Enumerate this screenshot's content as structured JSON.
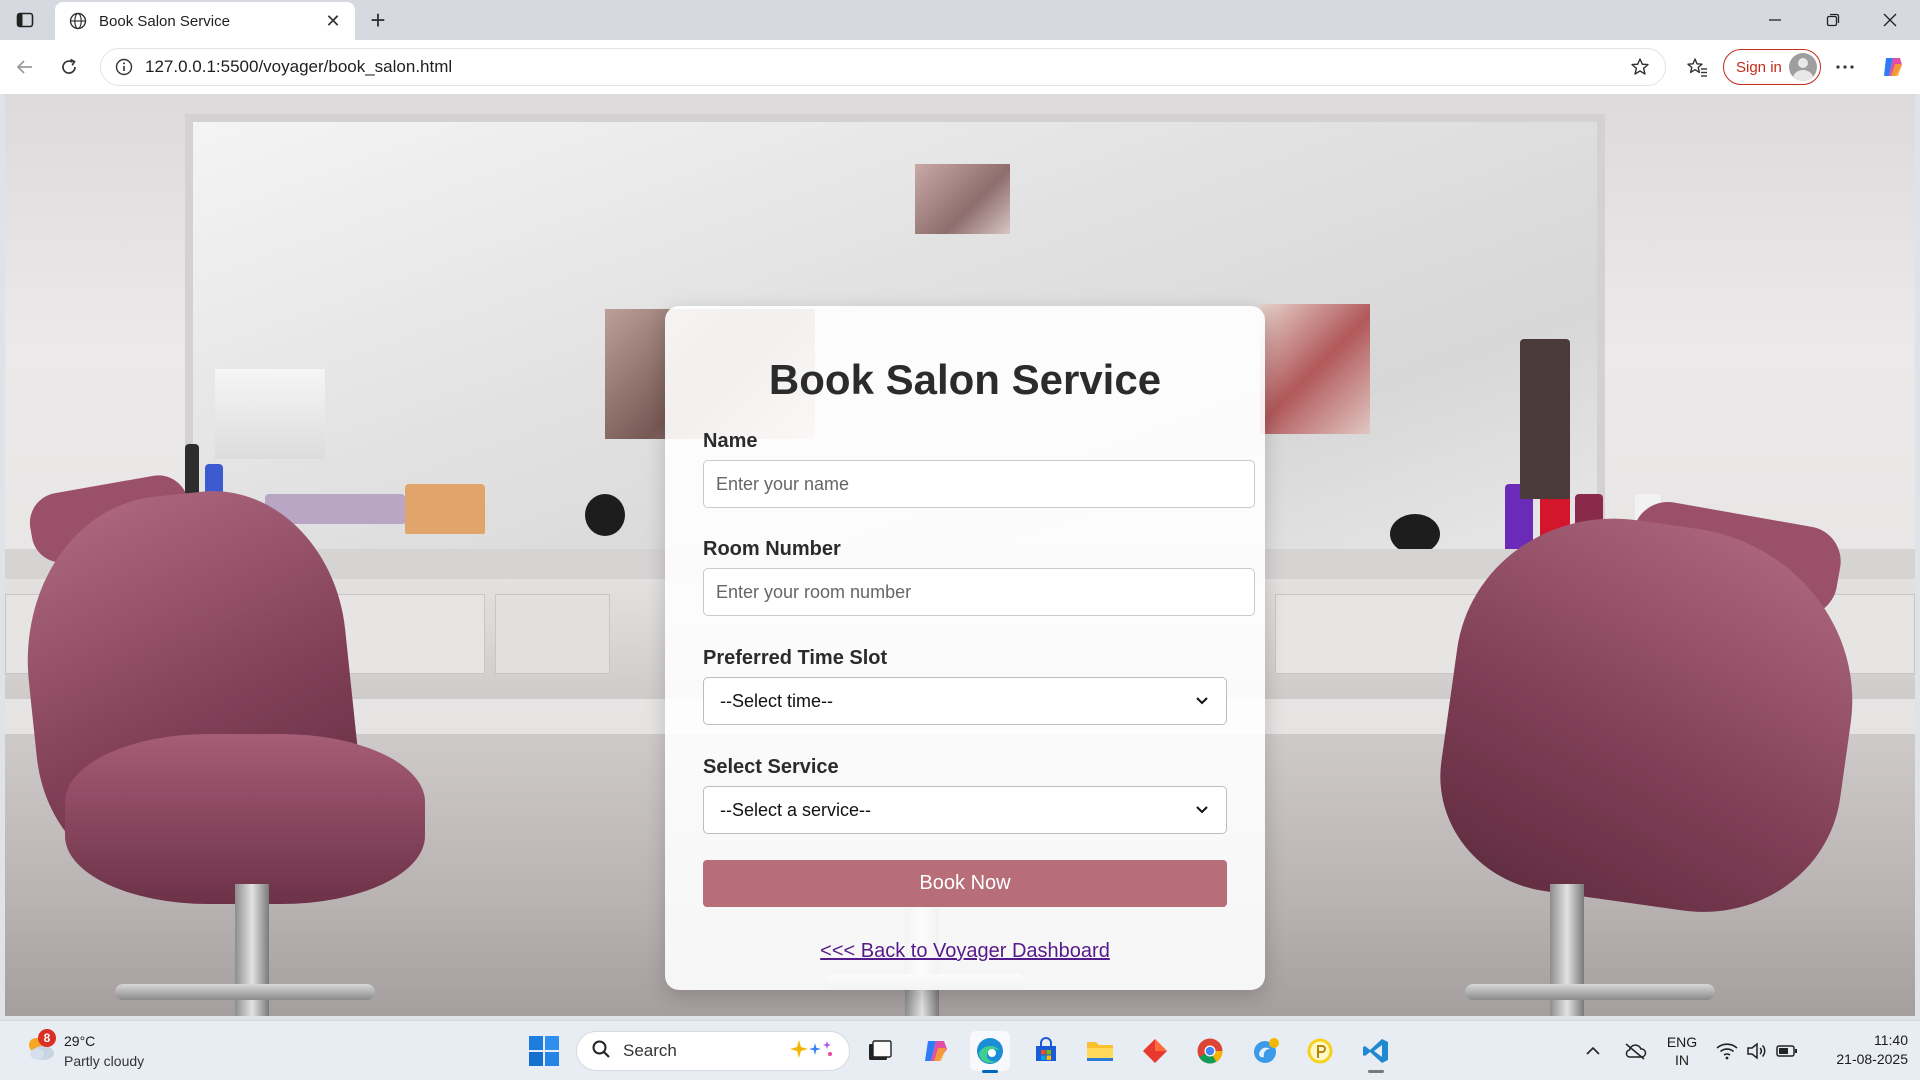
{
  "browser": {
    "tab_title": "Book Salon Service",
    "url": "127.0.0.1:5500/voyager/book_salon.html",
    "signin_label": "Sign in",
    "accent_color": "#c42b1c"
  },
  "form": {
    "title": "Book Salon Service",
    "name_label": "Name",
    "name_placeholder": "Enter your name",
    "room_label": "Room Number",
    "room_placeholder": "Enter your room number",
    "time_label": "Preferred Time Slot",
    "time_selected": "--Select time--",
    "service_label": "Select Service",
    "service_selected": "--Select a service--",
    "submit_label": "Book Now",
    "submit_color": "#b76e79",
    "back_link": "<<< Back to Voyager Dashboard"
  },
  "taskbar": {
    "weather_temp": "29°C",
    "weather_desc": "Partly cloudy",
    "weather_badge": "8",
    "search_placeholder": "Search",
    "lang_line1": "ENG",
    "lang_line2": "IN",
    "time": "11:40",
    "date": "21-08-2025"
  }
}
